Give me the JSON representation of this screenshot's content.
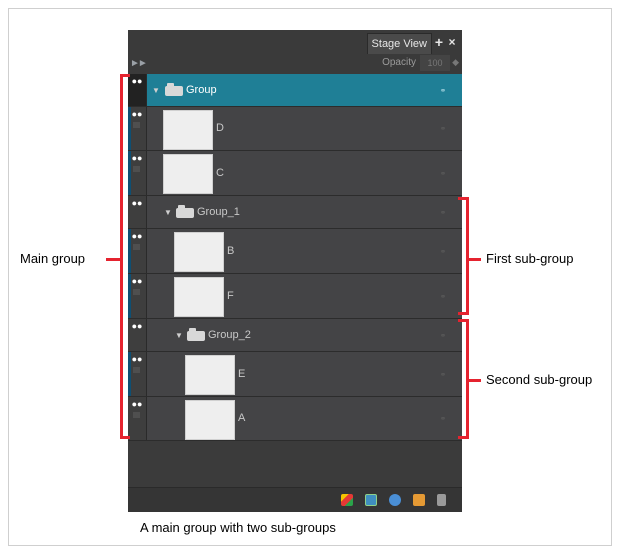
{
  "panel": {
    "tab_label": "Stage View",
    "add_tab": "+",
    "close_tab": "×",
    "expand": "►►",
    "opacity_label": "Opacity",
    "opacity_value": "100",
    "opacity_spin": "◆"
  },
  "layers": [
    {
      "name": "Group",
      "kind": "group",
      "level": 0,
      "selected": true
    },
    {
      "name": "D",
      "kind": "drawing",
      "level": 0
    },
    {
      "name": "C",
      "kind": "drawing",
      "level": 0
    },
    {
      "name": "Group_1",
      "kind": "group",
      "level": 1
    },
    {
      "name": "B",
      "kind": "drawing",
      "level": 1
    },
    {
      "name": "F",
      "kind": "drawing",
      "level": 1
    },
    {
      "name": "Group_2",
      "kind": "group",
      "level": 2
    },
    {
      "name": "E",
      "kind": "drawing",
      "level": 2
    },
    {
      "name": "A",
      "kind": "drawing",
      "level": 2
    }
  ],
  "icons": {
    "eye": "eye-icon",
    "lock": "lock-icon",
    "arrow": "▼",
    "link": "⚭"
  },
  "annotations": {
    "main_group": "Main group",
    "first_sub_group": "First sub-group",
    "second_sub_group": "Second sub-group"
  },
  "caption": "A main group with two sub-groups",
  "colors": {
    "selected_row": "#1f7f96",
    "bracket": "#e5232f",
    "panel_bg": "#3b3b3b"
  }
}
